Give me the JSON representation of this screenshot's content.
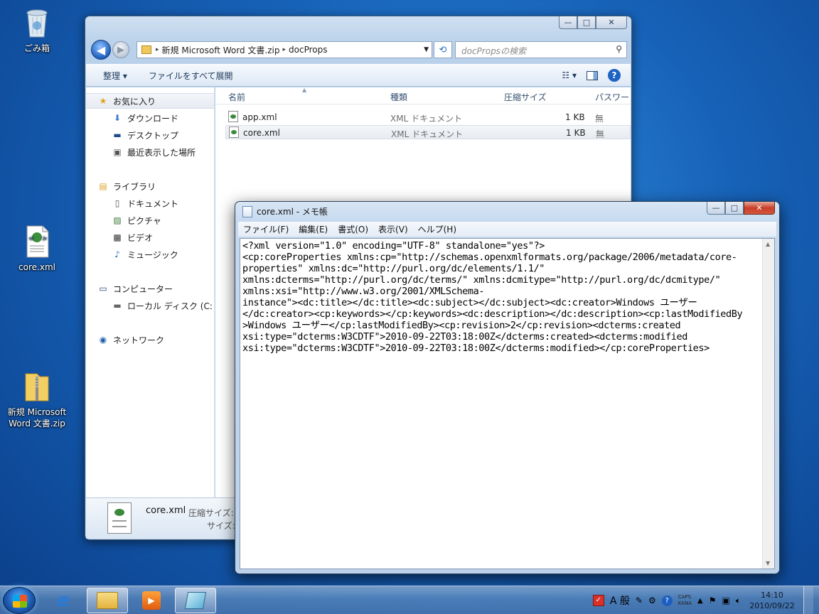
{
  "desktop": {
    "recycle_bin_label": "ごみ箱",
    "core_xml_label": "core.xml",
    "zip_label_line1": "新規 Microsoft",
    "zip_label_line2": "Word 文書.zip"
  },
  "explorer": {
    "address": {
      "segment1": "新規 Microsoft Word 文書.zip",
      "segment2": "docProps"
    },
    "search_placeholder": "docPropsの検索",
    "toolbar": {
      "organize": "整理 ▾",
      "extract_all": "ファイルをすべて展開"
    },
    "nav": {
      "favorites": "お気に入り",
      "downloads": "ダウンロード",
      "desktop": "デスクトップ",
      "recent": "最近表示した場所",
      "libraries": "ライブラリ",
      "documents": "ドキュメント",
      "pictures": "ピクチャ",
      "videos": "ビデオ",
      "music": "ミュージック",
      "computer": "コンピューター",
      "local_disk": "ローカル ディスク (C:",
      "network": "ネットワーク"
    },
    "columns": {
      "name": "名前",
      "type": "種類",
      "compressed_size": "圧縮サイズ",
      "password": "パスワー"
    },
    "files": [
      {
        "name": "app.xml",
        "type": "XML ドキュメント",
        "size": "1 KB",
        "password": "無"
      },
      {
        "name": "core.xml",
        "type": "XML ドキュメント",
        "size": "1 KB",
        "password": "無"
      }
    ],
    "details": {
      "name": "core.xml",
      "line1": "圧縮サイズ:",
      "line2": "サイズ:"
    }
  },
  "notepad": {
    "title": "core.xml - メモ帳",
    "menu": [
      "ファイル(F)",
      "編集(E)",
      "書式(O)",
      "表示(V)",
      "ヘルプ(H)"
    ],
    "content": "<?xml version=\"1.0\" encoding=\"UTF-8\" standalone=\"yes\"?>\n<cp:coreProperties xmlns:cp=\"http://schemas.openxmlformats.org/package/2006/metadata/core-\nproperties\" xmlns:dc=\"http://purl.org/dc/elements/1.1/\"\nxmlns:dcterms=\"http://purl.org/dc/terms/\" xmlns:dcmitype=\"http://purl.org/dc/dcmitype/\"\nxmlns:xsi=\"http://www.w3.org/2001/XMLSchema-\ninstance\"><dc:title></dc:title><dc:subject></dc:subject><dc:creator>Windows ユーザー\n</dc:creator><cp:keywords></cp:keywords><dc:description></dc:description><cp:lastModifiedBy\n>Windows ユーザー</cp:lastModifiedBy><cp:revision>2</cp:revision><dcterms:created\nxsi:type=\"dcterms:W3CDTF\">2010-09-22T03:18:00Z</dcterms:created><dcterms:modified\nxsi:type=\"dcterms:W3CDTF\">2010-09-22T03:18:00Z</dcterms:modified></cp:coreProperties>"
  },
  "taskbar": {
    "ime_mode": "A 般",
    "caps": "CAPS",
    "kana": "KANA",
    "time": "14:10",
    "date": "2010/09/22"
  }
}
